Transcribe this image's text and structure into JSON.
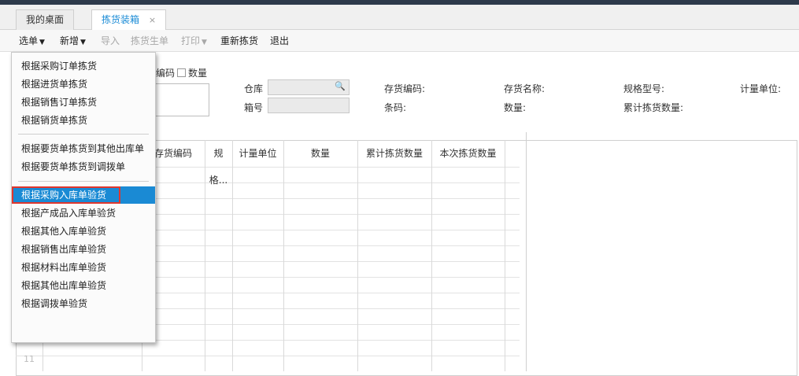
{
  "tabs": [
    {
      "label": "我的桌面"
    },
    {
      "label": "拣货装箱",
      "close": "×"
    }
  ],
  "toolbar": {
    "select": "选单",
    "new": "新增",
    "import": "导入",
    "gen": "拣货生单",
    "print": "打印",
    "repick": "重新拣货",
    "exit": "退出"
  },
  "form": {
    "code_label": "编码",
    "qty_label": "数量",
    "warehouse": "仓库",
    "box": "箱号"
  },
  "info": {
    "inv_code": "存货编码:",
    "inv_name": "存货名称:",
    "spec": "规格型号:",
    "unit": "计量单位:",
    "barcode": "条码:",
    "qty": "数量:",
    "cum": "累计拣货数量:"
  },
  "grid": {
    "headers": [
      "存货编码",
      "规格...",
      "计量单位",
      "数量",
      "累计拣货数量",
      "本次拣货数量"
    ],
    "last_row": "11"
  },
  "menu": {
    "items": [
      "根据采购订单拣货",
      "根据进货单拣货",
      "根据销售订单拣货",
      "根据销货单拣货",
      "根据要货单拣货到其他出库单",
      "根据要货单拣货到调拨单",
      "根据采购入库单验货",
      "根据产成品入库单验货",
      "根据其他入库单验货",
      "根据销售出库单验货",
      "根据材料出库单验货",
      "根据其他出库单验货",
      "根据调拨单验货"
    ]
  },
  "colors": {
    "accent": "#1a8ad4",
    "highlight_border": "#e0362c"
  }
}
